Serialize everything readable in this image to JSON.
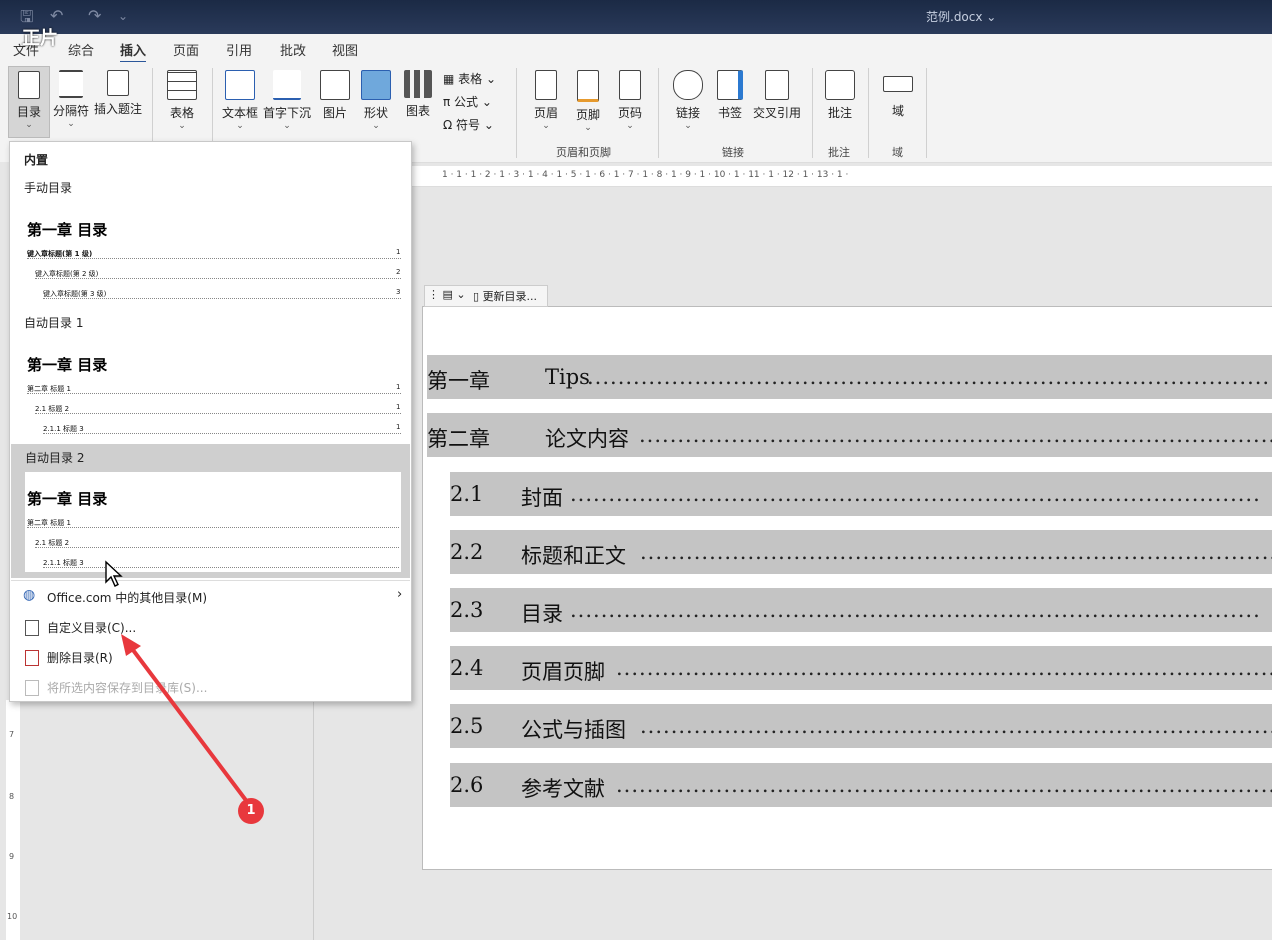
{
  "overlay_text": "正片",
  "document_title": "范例.docx ⌄",
  "quick_access": {
    "save": "🖫",
    "undo": "↶",
    "redo": "↷",
    "more": "⌄"
  },
  "tabs": [
    "文件",
    "综合",
    "插入",
    "页面",
    "引用",
    "批改",
    "视图"
  ],
  "active_tab": "插入",
  "ribbon": {
    "toc": "目录",
    "page_break": "分隔符",
    "insert_caption": "插入题注",
    "table": "表格",
    "textbox": "文本框",
    "dropcap": "首字下沉",
    "picture": "图片",
    "shapes": "形状",
    "chart": "图表",
    "small_table": "表格",
    "formula": "公式",
    "symbol": "符号",
    "header": "页眉",
    "footer": "页脚",
    "page_number": "页码",
    "link": "链接",
    "bookmark": "书签",
    "cross_ref": "交叉引用",
    "comment": "批注",
    "field": "域",
    "groups": {
      "header_footer": "页眉和页脚",
      "links": "链接",
      "comments": "批注",
      "field": "域"
    }
  },
  "ruler_text": "1 · 1 · 1 · 2 · 1 · 3 · 1 · 4 · 1 · 5 · 1 · 6 · 1 · 7 · 1 · 8 · 1 · 9 · 1 · 10 · 1 · 11 · 1 · 12 · 1 · 13 · 1 ·",
  "toc_control": {
    "update_label": "更新目录..."
  },
  "toc_entries": [
    {
      "num": "第一章",
      "title": "Tips"
    },
    {
      "num": "第二章",
      "title": "论文内容"
    },
    {
      "num": "2.1",
      "title": "封面"
    },
    {
      "num": "2.2",
      "title": "标题和正文"
    },
    {
      "num": "2.3",
      "title": "目录"
    },
    {
      "num": "2.4",
      "title": "页眉页脚"
    },
    {
      "num": "2.5",
      "title": "公式与插图"
    },
    {
      "num": "2.6",
      "title": "参考文献"
    }
  ],
  "dropdown": {
    "section_builtin": "内置",
    "manual_toc": "手动目录",
    "auto_toc_1": "自动目录 1",
    "auto_toc_2": "自动目录 2",
    "preview_title": "第一章 目录",
    "manual_lines": [
      "键入章标题(第 1 级)",
      "键入章标题(第 2 级)",
      "键入章标题(第 3 级)"
    ],
    "manual_pages": [
      "1",
      "2",
      "3"
    ],
    "auto_lines": [
      "第二章     标题 1",
      "2.1     标题 2",
      "2.1.1     标题 3"
    ],
    "auto_pages": [
      "1",
      "1",
      "1"
    ],
    "more_from_office": "Office.com 中的其他目录(M)",
    "custom_toc": "自定义目录(C)...",
    "remove_toc": "删除目录(R)",
    "save_selection": "将所选内容保存到目录库(S)..."
  },
  "annotation": "1",
  "vruler_ticks": [
    "7",
    "8",
    "9",
    "10"
  ]
}
